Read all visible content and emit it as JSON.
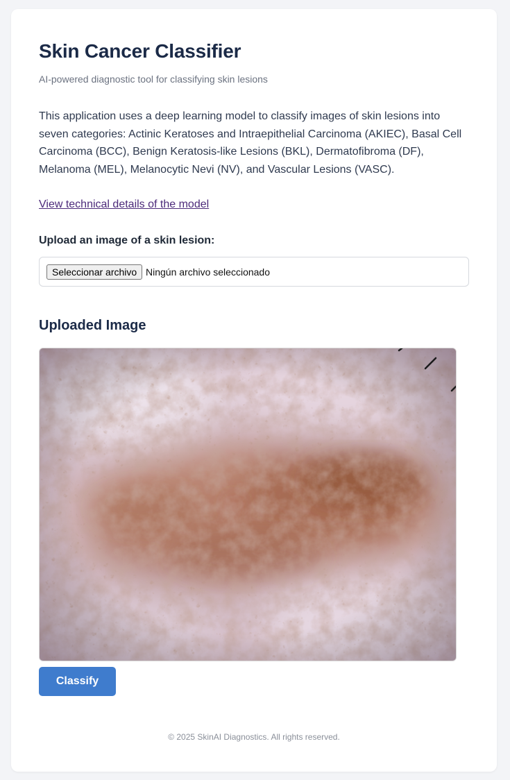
{
  "header": {
    "title": "Skin Cancer Classifier",
    "subtitle": "AI-powered diagnostic tool for classifying skin lesions"
  },
  "main": {
    "description": "This application uses a deep learning model to classify images of skin lesions into seven categories: Actinic Keratoses and Intraepithelial Carcinoma (AKIEC), Basal Cell Carcinoma (BCC), Benign Keratosis-like Lesions (BKL), Dermatofibroma (DF), Melanoma (MEL), Melanocytic Nevi (NV), and Vascular Lesions (VASC).",
    "tech_link": "View technical details of the model",
    "upload": {
      "label": "Upload an image of a skin lesion:",
      "button_label": "Seleccionar archivo",
      "status": "Ningún archivo seleccionado"
    },
    "image_section": {
      "heading": "Uploaded Image"
    },
    "classify_label": "Classify"
  },
  "footer": {
    "text": "© 2025 SkinAI Diagnostics. All rights reserved."
  },
  "colors": {
    "accent": "#3f7ccd",
    "title": "#1b2a47",
    "link": "#4c2a7a",
    "background": "#f3f4f7"
  }
}
